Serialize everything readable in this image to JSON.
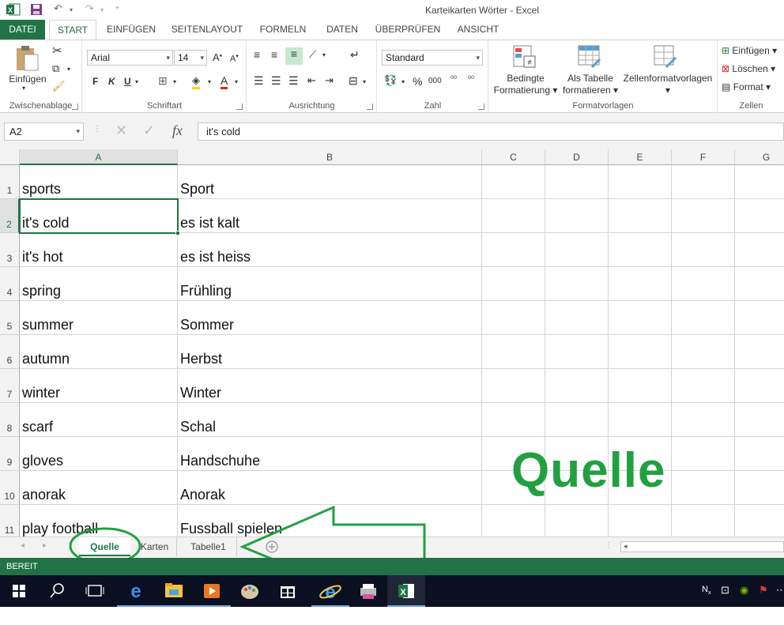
{
  "window": {
    "title": "Karteikarten Wörter - Excel"
  },
  "ribbon_tabs": [
    "DATEI",
    "START",
    "EINFÜGEN",
    "SEITENLAYOUT",
    "FORMELN",
    "DATEN",
    "ÜBERPRÜFEN",
    "ANSICHT"
  ],
  "clipboard": {
    "paste_label": "Einfügen",
    "group_label": "Zwischenablage"
  },
  "font": {
    "name": "Arial",
    "size": "14",
    "bold": "F",
    "italic": "K",
    "underline": "U",
    "group_label": "Schriftart"
  },
  "alignment": {
    "group_label": "Ausrichtung"
  },
  "number": {
    "format": "Standard",
    "percent": "%",
    "thousands": "000",
    "group_label": "Zahl"
  },
  "styles": {
    "conditional_line1": "Bedingte",
    "conditional_line2": "Formatierung",
    "table_line1": "Als Tabelle",
    "table_line2": "formatieren",
    "cellstyles": "Zellenformatvorlagen",
    "group_label": "Formatvorlagen"
  },
  "cells_group": {
    "insert": "Einfügen",
    "delete": "Löschen",
    "format": "Format",
    "group_label": "Zellen"
  },
  "formula_bar": {
    "name_box": "A2",
    "fx": "fx",
    "content": "it's cold"
  },
  "columns": [
    "A",
    "B",
    "C",
    "D",
    "E",
    "F",
    "G"
  ],
  "rows": [
    {
      "num": "1",
      "a": "sports",
      "b": "Sport"
    },
    {
      "num": "2",
      "a": "it's cold",
      "b": "es ist kalt"
    },
    {
      "num": "3",
      "a": "it's hot",
      "b": "es ist heiss"
    },
    {
      "num": "4",
      "a": "spring",
      "b": "Frühling"
    },
    {
      "num": "5",
      "a": "summer",
      "b": "Sommer"
    },
    {
      "num": "6",
      "a": "autumn",
      "b": "Herbst"
    },
    {
      "num": "7",
      "a": "winter",
      "b": "Winter"
    },
    {
      "num": "8",
      "a": "scarf",
      "b": "Schal"
    },
    {
      "num": "9",
      "a": "gloves",
      "b": "Handschuhe"
    },
    {
      "num": "10",
      "a": "anorak",
      "b": "Anorak"
    },
    {
      "num": "11",
      "a": "play football",
      "b": "Fussball spielen"
    }
  ],
  "annotation": {
    "text": "Quelle",
    "color": "#22a040"
  },
  "sheets": [
    "Quelle",
    "Karten",
    "Tabelle1"
  ],
  "status": {
    "text": "BEREIT"
  },
  "colors": {
    "accent": "#217346",
    "taskbar": "#0a0f22"
  }
}
